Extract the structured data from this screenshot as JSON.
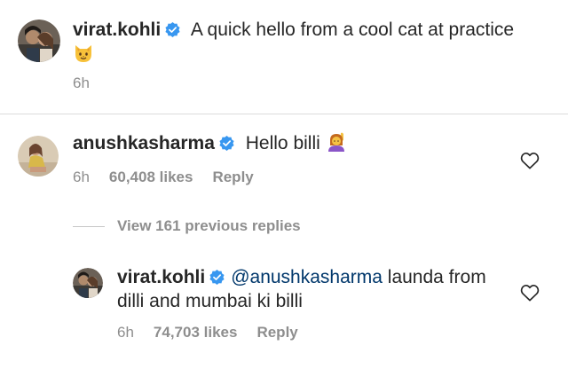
{
  "caption": {
    "username": "virat.kohli",
    "text": " A quick hello from a cool cat at practice",
    "emoji": "cat-face",
    "time": "6h"
  },
  "comment": {
    "username": "anushkasharma",
    "text": " Hello billi ",
    "emoji": "person-raising-hand",
    "time": "6h",
    "likes": "60,408 likes",
    "reply_label": "Reply"
  },
  "view_replies": "View 161 previous replies",
  "reply": {
    "username": "virat.kohli",
    "mention": "@anushkasharma",
    "text": " launda from dilli and mumbai ki billi",
    "time": "6h",
    "likes": "74,703 likes",
    "reply_label": "Reply"
  },
  "colors": {
    "username": "#262626",
    "muted": "#8e8e8e",
    "mention": "#00376b",
    "verified": "#3897f0",
    "divider": "#dbdbdb"
  }
}
